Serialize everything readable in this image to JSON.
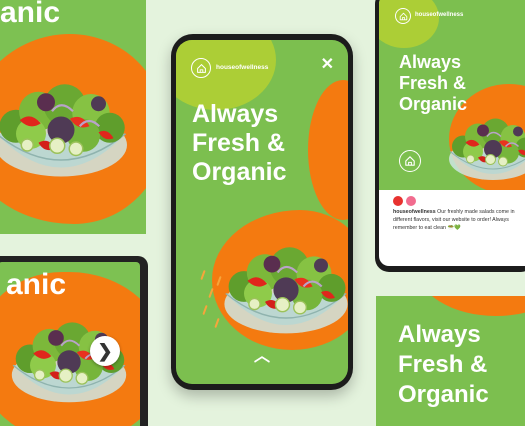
{
  "brand": {
    "handle": "houseofwellness",
    "headline_lines": [
      "Always",
      "Fresh &",
      "Organic"
    ],
    "partial_headline": "anic",
    "colors": {
      "background": "#e4f3dd",
      "green": "#7cbf4f",
      "orange": "#f47a10",
      "lime": "#b8d22f"
    }
  },
  "story": {
    "close_icon": "✕",
    "swipe_icon": "︿"
  },
  "tablet": {
    "next_icon": "❯"
  },
  "feed_post": {
    "caption_handle": "houseofwellness",
    "caption_text": " Our freshly made salads come in different flavors, visit our website to order! Always remember to eat clean 🥗💚"
  }
}
